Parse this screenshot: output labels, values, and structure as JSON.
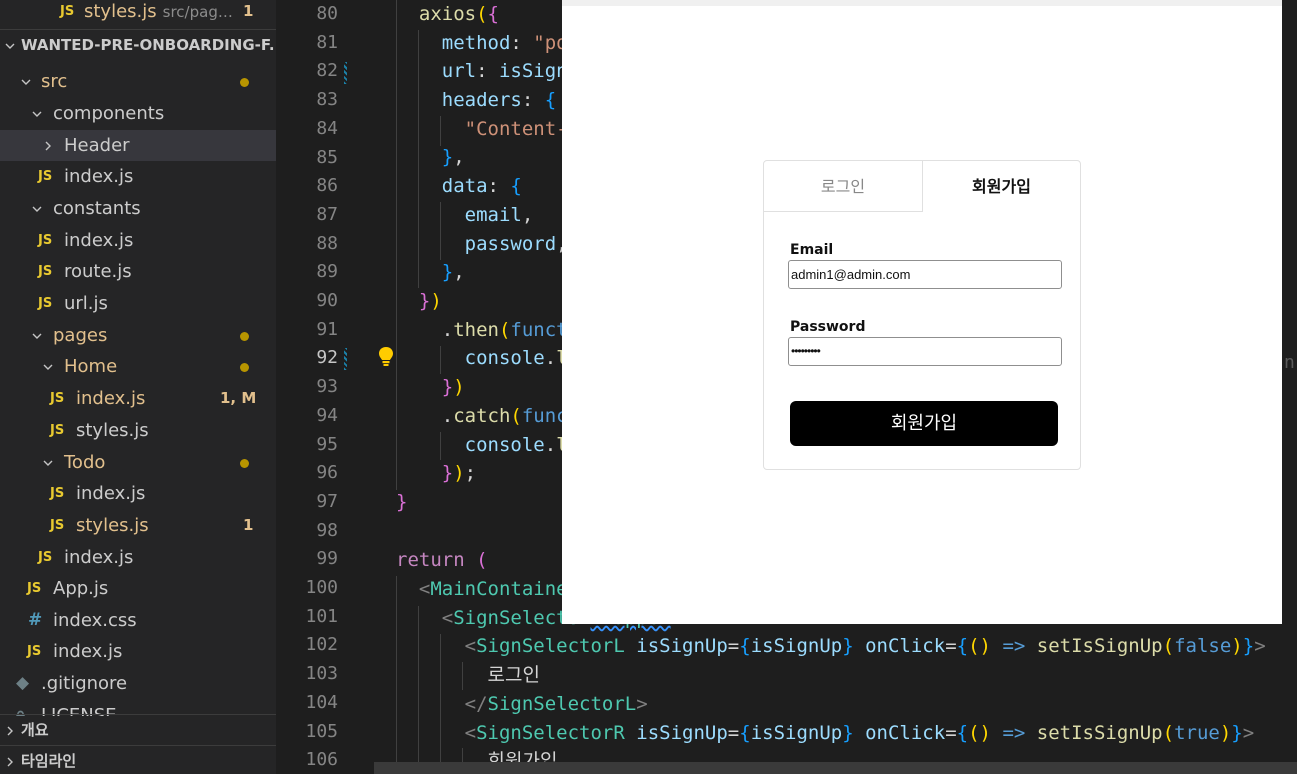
{
  "explorer": {
    "open_editor": {
      "name": "styles.js",
      "path": "src/pag…",
      "badge": "1"
    },
    "project": "WANTED-PRE-ONBOARDING-F...",
    "tree": [
      {
        "label": "src",
        "type": "folder",
        "dot": true
      },
      {
        "label": "components",
        "type": "folder"
      },
      {
        "label": "Header",
        "type": "folder-collapsed",
        "selected": true
      },
      {
        "label": "index.js",
        "type": "js"
      },
      {
        "label": "constants",
        "type": "folder"
      },
      {
        "label": "index.js",
        "type": "js"
      },
      {
        "label": "route.js",
        "type": "js"
      },
      {
        "label": "url.js",
        "type": "js"
      },
      {
        "label": "pages",
        "type": "folder",
        "dot": true
      },
      {
        "label": "Home",
        "type": "folder",
        "dot": true
      },
      {
        "label": "index.js",
        "type": "js",
        "badge": "1, M"
      },
      {
        "label": "styles.js",
        "type": "js"
      },
      {
        "label": "Todo",
        "type": "folder",
        "dot": true
      },
      {
        "label": "index.js",
        "type": "js"
      },
      {
        "label": "styles.js",
        "type": "js",
        "badge": "1"
      },
      {
        "label": "index.js",
        "type": "js"
      },
      {
        "label": "App.js",
        "type": "js"
      },
      {
        "label": "index.css",
        "type": "css"
      },
      {
        "label": "index.js",
        "type": "js"
      },
      {
        "label": ".gitignore",
        "type": "git"
      },
      {
        "label": "LICENSE",
        "type": "file"
      }
    ],
    "file_icon_js": "JS",
    "file_icon_css": "#",
    "sections": {
      "outline": "개요",
      "timeline": "타임라인"
    }
  },
  "editor": {
    "line_numbers": [
      "80",
      "81",
      "82",
      "83",
      "84",
      "85",
      "86",
      "87",
      "88",
      "89",
      "90",
      "91",
      "92",
      "93",
      "94",
      "95",
      "96",
      "97",
      "98",
      "99",
      "100",
      "101",
      "102",
      "103",
      "104",
      "105",
      "106"
    ],
    "current_line": "92",
    "ghost_char": "n"
  },
  "preview": {
    "tabs": {
      "login": "로그인",
      "signup": "회원가입"
    },
    "email": {
      "label": "Email",
      "value": "admin1@admin.com"
    },
    "password": {
      "label": "Password",
      "value": "•••••••••"
    },
    "submit_label": "회원가입"
  },
  "colors": {
    "accent_yellow": "#e8c930",
    "modified": "#e2c08d",
    "editor_bg": "#1e1e1e",
    "sidebar_bg": "#252526"
  }
}
